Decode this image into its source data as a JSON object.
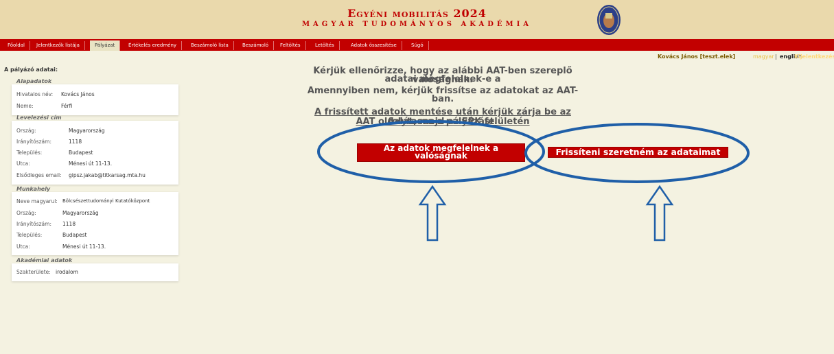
{
  "header": {
    "title": "Egyéni mobilitás 2024",
    "subtitle": "MAGYAR TUDOMÁNYOS AKADÉMIA"
  },
  "nav": {
    "items": [
      "Főoldal",
      "Jelentkezők listája",
      "Pályázat",
      "Értékelés eredmény",
      "Beszámoló lista",
      "Beszámoló",
      "Feltöltés",
      "Letöltés",
      "Adatok összesítése",
      "Súgó"
    ],
    "active": "Pályázat"
  },
  "userbar": {
    "user": "Kovács János [teszt.elek]",
    "lang_hu": "magyar",
    "separator": "|",
    "lang_en": "english",
    "logout": "Kijelentkezés"
  },
  "sidebar": {
    "title": "A pályázó adatai:",
    "alapadatok": {
      "heading": "Alapadatok",
      "rows": [
        {
          "label": "Hivatalos név:",
          "value": "Kovács János"
        },
        {
          "label": "Neme:",
          "value": "Férfi"
        }
      ]
    },
    "levelezesi": {
      "heading": "Levelezési cím",
      "rows": [
        {
          "label": "Ország:",
          "value": "Magyarország"
        },
        {
          "label": "Irányítószám:",
          "value": "1118"
        },
        {
          "label": "Település:",
          "value": "Budapest"
        },
        {
          "label": "Utca:",
          "value": "Ménesi út 11-13."
        },
        {
          "label": "Elsődleges email:",
          "value": "gipsz.jakab@titkarsag.mta.hu"
        }
      ]
    },
    "munkahely": {
      "heading": "Munkahely",
      "rows": [
        {
          "label": "Neve magyarul:",
          "value": "Bölcsészettudományi Kutatóközpont"
        },
        {
          "label": "Ország:",
          "value": "Magyarország"
        },
        {
          "label": "Irányítószám:",
          "value": "1118"
        },
        {
          "label": "Település:",
          "value": "Budapest"
        },
        {
          "label": "Utca:",
          "value": "Ménesi út 11-13."
        }
      ]
    },
    "akademiai": {
      "heading": "Akadémiai adatok",
      "rows": [
        {
          "label": "Szakterülete:",
          "value": "irodalom"
        }
      ]
    }
  },
  "main": {
    "msg_line1": "Kérjük ellenőrizze, hogy az alábbi AAT-ben szereplő adatai megfelelnek-e a",
    "msg_line2": "valóságnak.",
    "msg_line3": "Amennyiben nem, kérjük frissítse az adatokat az AAT-ban.",
    "msg2_line1": "A frissített adatok mentése után kérjük zárja be az AAT oldalát, majd az EPK felületén",
    "msg2_line2": "folytassa a pályázást.",
    "btn_ok_line1": "Az adatok megfelelnek a",
    "btn_ok_line2": "valóságnak",
    "btn_update": "Frissíteni szeretném az adataimat"
  },
  "colors": {
    "accent": "#c20000",
    "annotation": "#1f5fa8",
    "background": "#f4f2e1",
    "header": "#ead9ac"
  }
}
